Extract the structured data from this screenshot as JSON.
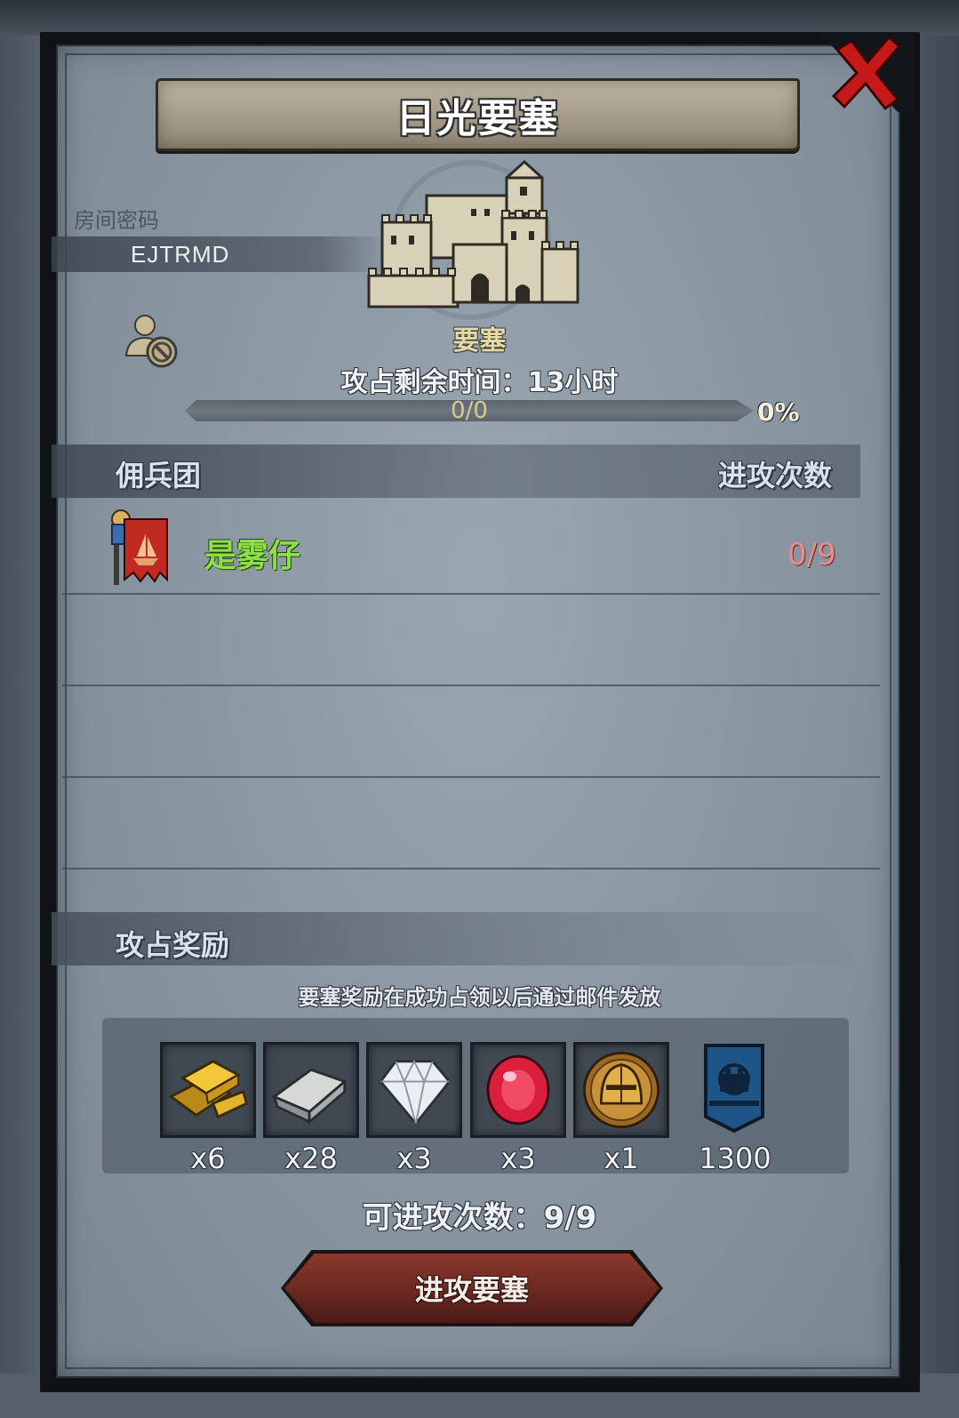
{
  "dialog": {
    "title": "日光要塞",
    "room_password_label": "房间密码",
    "room_password": "EJTRMD",
    "fortress_label": "要塞",
    "remaining_time": "攻占剩余时间：13小时",
    "progress": {
      "text": "0/0",
      "percent_text": "0%",
      "value": 0
    }
  },
  "mercenary": {
    "header_left": "佣兵团",
    "header_right": "进攻次数",
    "rows": [
      {
        "name": "是雾仔",
        "attacks": "0/9",
        "name_color": "#8de04a",
        "count_color": "#f08a8a"
      }
    ]
  },
  "rewards": {
    "header": "攻占奖励",
    "note": "要塞奖励在成功占领以后通过邮件发放",
    "items": [
      {
        "icon": "gold-bar-icon",
        "count": "x6"
      },
      {
        "icon": "silver-bar-icon",
        "count": "x28"
      },
      {
        "icon": "diamond-icon",
        "count": "x3"
      },
      {
        "icon": "ruby-icon",
        "count": "x3"
      },
      {
        "icon": "knight-helmet-coin-icon",
        "count": "x1"
      },
      {
        "icon": "fortress-banner-icon",
        "count": "1300"
      }
    ]
  },
  "footer": {
    "attacks_available": "可进攻次数：9/9",
    "attack_button": "进攻要塞"
  },
  "colors": {
    "accent_red": "#6a2820",
    "gold": "#c8a24a"
  }
}
